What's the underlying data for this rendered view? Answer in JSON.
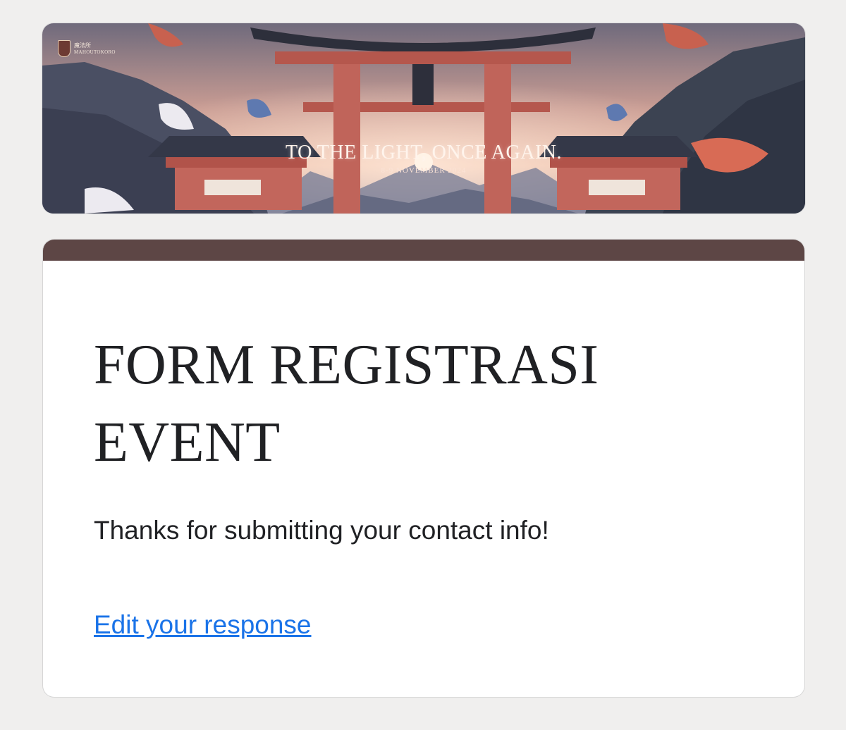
{
  "banner": {
    "logo_kanji": "魔法所",
    "logo_name": "MAHOUTOKORO",
    "title": "TO THE LIGHT, ONCE AGAIN.",
    "date": "8-9 NOVEMBER 2024"
  },
  "form": {
    "accent_color": "#5d4645",
    "title": "FORM REGISTRASI EVENT",
    "confirmation_message": "Thanks for submitting your contact info!",
    "edit_link_label": "Edit your response",
    "link_color": "#1a73e8"
  }
}
